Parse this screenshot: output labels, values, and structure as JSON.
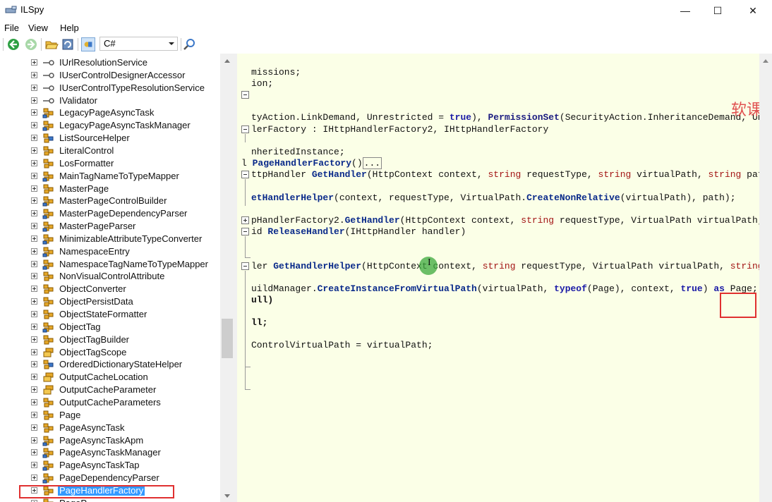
{
  "window": {
    "title": "ILSpy",
    "minimize": "—",
    "maximize": "☐",
    "close": "✕"
  },
  "menu": [
    "File",
    "View",
    "Help"
  ],
  "toolbar": {
    "language": "C#",
    "icons": [
      "back-icon",
      "forward-icon",
      "open-icon",
      "reload-icon",
      "options-icon",
      "search-icon"
    ]
  },
  "tree": {
    "items": [
      {
        "label": "IUrlResolutionService",
        "icon": "interface"
      },
      {
        "label": "IUserControlDesignerAccessor",
        "icon": "interface"
      },
      {
        "label": "IUserControlTypeResolutionService",
        "icon": "interface"
      },
      {
        "label": "IValidator",
        "icon": "interface"
      },
      {
        "label": "LegacyPageAsyncTask",
        "icon": "class"
      },
      {
        "label": "LegacyPageAsyncTaskManager",
        "icon": "class"
      },
      {
        "label": "ListSourceHelper",
        "icon": "static-class"
      },
      {
        "label": "LiteralControl",
        "icon": "class-public"
      },
      {
        "label": "LosFormatter",
        "icon": "class-public"
      },
      {
        "label": "MainTagNameToTypeMapper",
        "icon": "class"
      },
      {
        "label": "MasterPage",
        "icon": "class-public"
      },
      {
        "label": "MasterPageControlBuilder",
        "icon": "class"
      },
      {
        "label": "MasterPageDependencyParser",
        "icon": "class"
      },
      {
        "label": "MasterPageParser",
        "icon": "class"
      },
      {
        "label": "MinimizableAttributeTypeConverter",
        "icon": "class"
      },
      {
        "label": "NamespaceEntry",
        "icon": "class"
      },
      {
        "label": "NamespaceTagNameToTypeMapper",
        "icon": "class"
      },
      {
        "label": "NonVisualControlAttribute",
        "icon": "class-public"
      },
      {
        "label": "ObjectConverter",
        "icon": "class-public"
      },
      {
        "label": "ObjectPersistData",
        "icon": "class-public"
      },
      {
        "label": "ObjectStateFormatter",
        "icon": "class-public"
      },
      {
        "label": "ObjectTag",
        "icon": "class"
      },
      {
        "label": "ObjectTagBuilder",
        "icon": "class-public"
      },
      {
        "label": "ObjectTagScope",
        "icon": "enum"
      },
      {
        "label": "OrderedDictionaryStateHelper",
        "icon": "static-class"
      },
      {
        "label": "OutputCacheLocation",
        "icon": "enum"
      },
      {
        "label": "OutputCacheParameter",
        "icon": "enum"
      },
      {
        "label": "OutputCacheParameters",
        "icon": "class-public"
      },
      {
        "label": "Page",
        "icon": "class-public"
      },
      {
        "label": "PageAsyncTask",
        "icon": "class-public"
      },
      {
        "label": "PageAsyncTaskApm",
        "icon": "class"
      },
      {
        "label": "PageAsyncTaskManager",
        "icon": "class"
      },
      {
        "label": "PageAsyncTaskTap",
        "icon": "class"
      },
      {
        "label": "PageDependencyParser",
        "icon": "class"
      },
      {
        "label": "PageHandlerFactory",
        "icon": "class-public",
        "selected": true
      },
      {
        "label": "PageP...",
        "icon": "class"
      }
    ]
  },
  "code": {
    "l1": "missions;",
    "l2": "ion;",
    "l3a": "tyAction.LinkDemand, Unrestricted = ",
    "l3b": "true",
    "l3c": "), ",
    "l3d": "PermissionSet",
    "l3e": "(SecurityAction.InheritanceDemand, Unr",
    "l4": "lerFactory : IHttpHandlerFactory2, IHttpHandlerFactory",
    "l5": "nheritedInstance;",
    "l6a": "l ",
    "l6b": "PageHandlerFactory",
    "l6c": "()",
    "l6d": "...",
    "l7a": "ttpHandler ",
    "l7b": "GetHandler",
    "l7c": "(HttpContext context, ",
    "l7d": "string",
    "l7e": " requestType, ",
    "l7f": "string",
    "l7g": " virtualPath, ",
    "l7h": "string",
    "l7i": " path",
    "l8a": "etHandlerHelper",
    "l8b": "(context, requestType, VirtualPath.",
    "l8c": "CreateNonRelative",
    "l8d": "(virtualPath), path);",
    "l9a": "pHandlerFactory2.",
    "l9b": "GetHandler",
    "l9c": "(HttpContext context, ",
    "l9d": "string",
    "l9e": " requestType, VirtualPath virtualPath,",
    "l10a": "id ",
    "l10b": "ReleaseHandler",
    "l10c": "(IHttpHandler handler)",
    "l11a": "ler ",
    "l11b": "GetHandlerHelper",
    "l11c": "(HttpContext context, ",
    "l11d": "string",
    "l11e": " requestType, VirtualPath virtualPath, ",
    "l11f": "string",
    "l12a": "uildManager.",
    "l12b": "CreateInstanceFromVirtualPath",
    "l12c": "(virtualPath, ",
    "l12d": "typeof",
    "l12e": "(Page), context, ",
    "l12f": "true",
    "l12g": ") ",
    "l12h": "as",
    "l12i": " Page;",
    "l13": "ull)",
    "l14": "ll;",
    "l15": "ControlVirtualPath = virtualPath;",
    "watermark": "软课"
  }
}
